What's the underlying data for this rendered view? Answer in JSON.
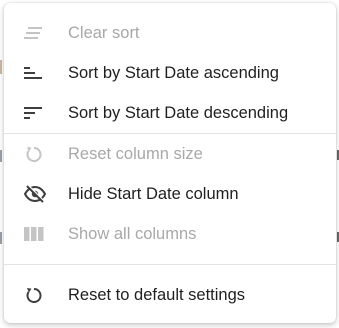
{
  "menu": {
    "items": [
      {
        "label": "Clear sort",
        "icon": "clear-sort-icon",
        "enabled": false
      },
      {
        "label": "Sort by Start Date ascending",
        "icon": "sort-ascending-icon",
        "enabled": true
      },
      {
        "label": "Sort by Start Date descending",
        "icon": "sort-descending-icon",
        "enabled": true
      },
      {
        "label": "Reset column size",
        "icon": "reset-icon",
        "enabled": false
      },
      {
        "label": "Hide Start Date column",
        "icon": "eye-off-icon",
        "enabled": true
      },
      {
        "label": "Show all columns",
        "icon": "columns-icon",
        "enabled": false
      },
      {
        "label": "Reset to default settings",
        "icon": "reset-icon",
        "enabled": true
      }
    ]
  },
  "colors": {
    "text": "#1f1f1f",
    "disabled_text": "#a8a8a8",
    "icon": "#3f3f3f",
    "disabled_icon": "#c4c4c4",
    "divider": "#e3e3e3",
    "background": "#ffffff"
  }
}
